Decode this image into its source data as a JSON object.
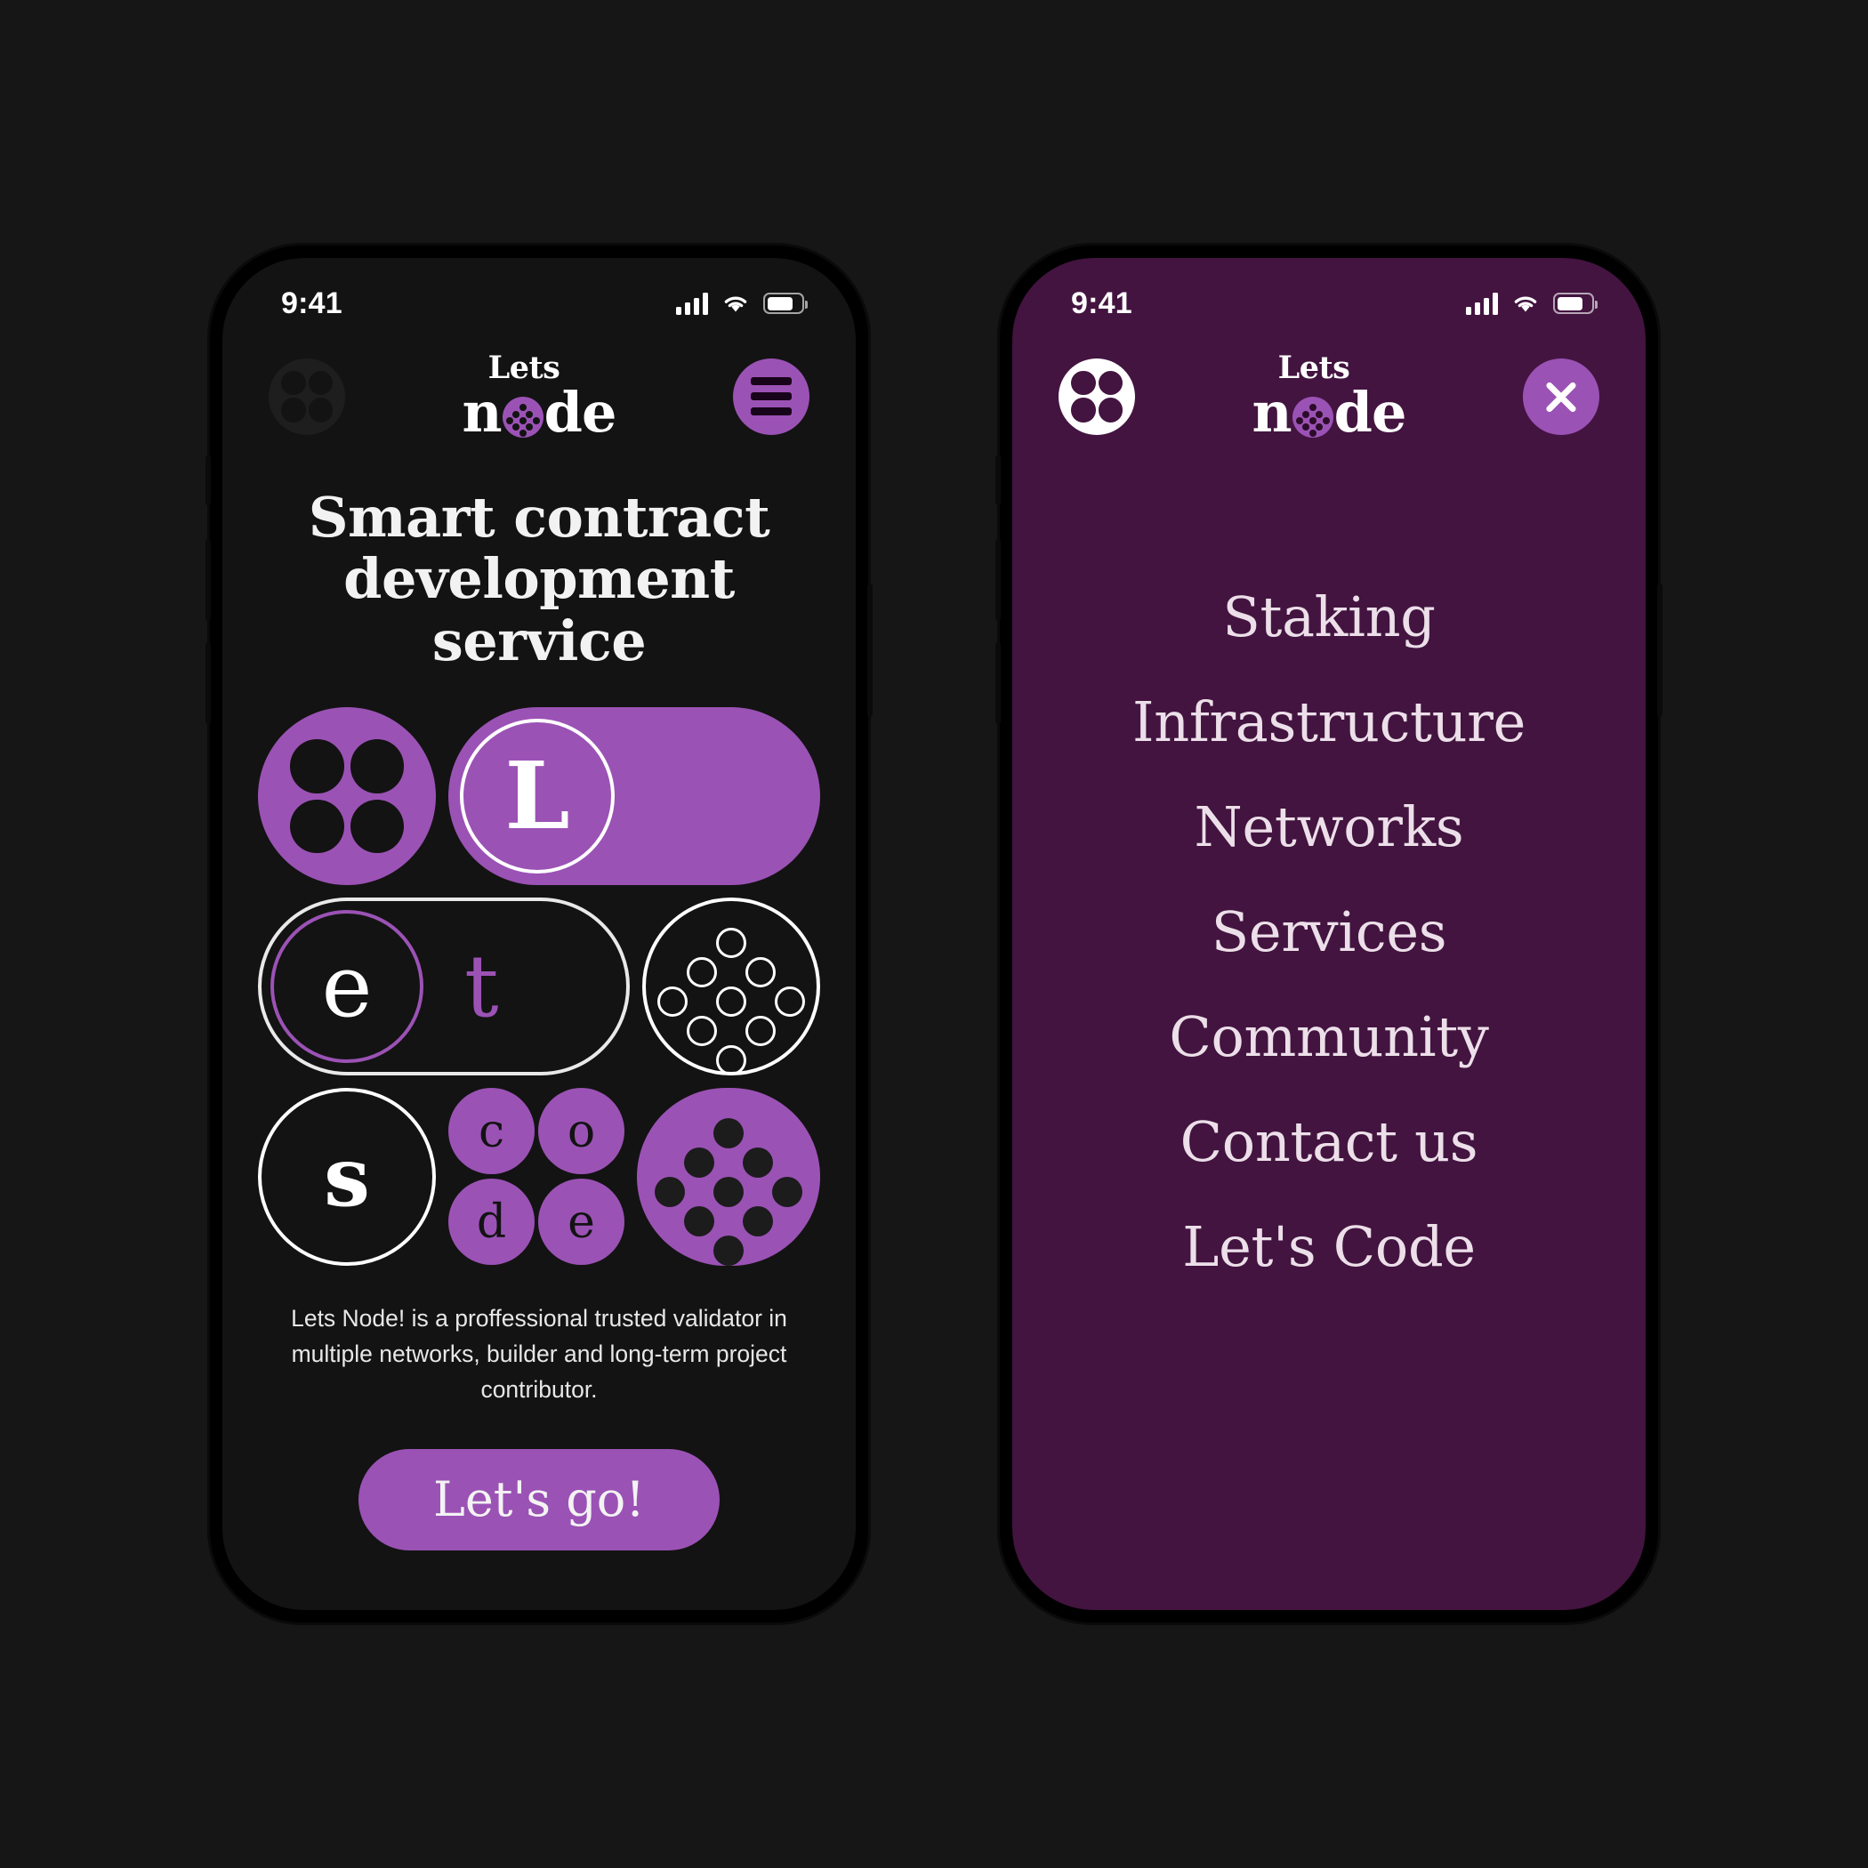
{
  "theme": {
    "page_bg": "#161616",
    "screen_dark_bg": "#131313",
    "screen_menu_bg": "#431440",
    "accent_purple": "#9b52b5",
    "text_light": "#f2f2f2"
  },
  "status_bar": {
    "time": "9:41",
    "signal_icon": "cellular-signal-icon",
    "wifi_icon": "wifi-icon",
    "battery_icon": "battery-icon",
    "battery_level": "78%"
  },
  "brand": {
    "line1": "Lets",
    "n": "n",
    "o": "o",
    "de": "de",
    "full": "Lets node",
    "logo_icon": "lets-node-dots-logo-icon"
  },
  "home_screen": {
    "header": {
      "left_logo_icon": "lets-node-dots-logo-icon",
      "menu_button_icon": "hamburger-menu-icon",
      "menu_button_label": "Open menu"
    },
    "headline_line1": "Smart contract",
    "headline_line2": "development service",
    "tiles": {
      "row1": {
        "logo_tile_icon": "four-dots-logo-icon",
        "letter": "L"
      },
      "row2": {
        "letter_a": "e",
        "letter_b": "t",
        "node_cluster_icon": "node-cluster-outline-icon"
      },
      "row3": {
        "letter": "s",
        "code_letters": [
          "c",
          "o",
          "d",
          "e"
        ],
        "node_cluster_icon": "node-cluster-solid-icon"
      }
    },
    "blurb": "Lets Node! is a proffessional trusted validator in multiple networks, builder and long-term project contributor.",
    "cta_label": "Let's go!"
  },
  "menu_screen": {
    "header": {
      "left_logo_icon": "lets-node-dots-logo-icon",
      "close_button_icon": "close-x-icon",
      "close_button_label": "Close menu"
    },
    "items": [
      {
        "label": "Staking"
      },
      {
        "label": "Infrastructure"
      },
      {
        "label": "Networks"
      },
      {
        "label": "Services"
      },
      {
        "label": "Community"
      },
      {
        "label": "Contact us"
      },
      {
        "label": "Let's Code"
      }
    ]
  }
}
